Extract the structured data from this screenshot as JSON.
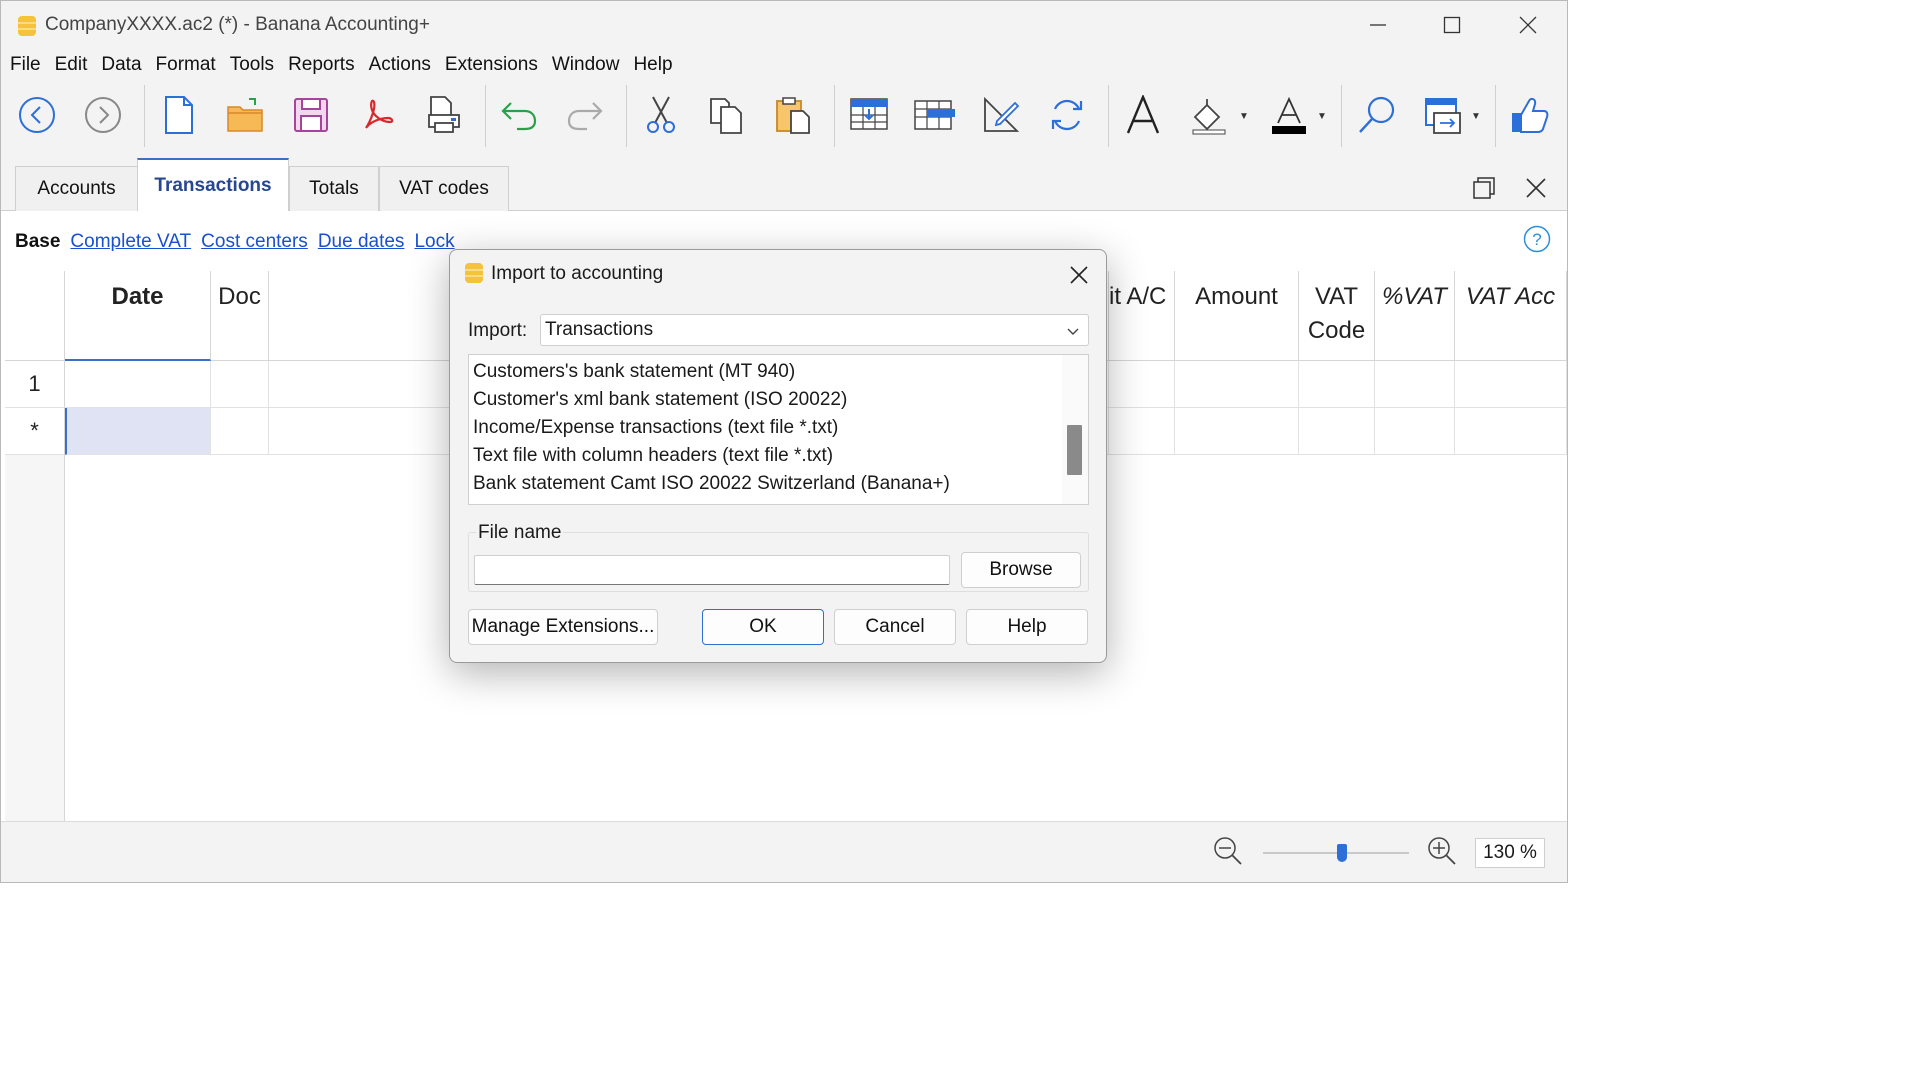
{
  "window": {
    "title": "CompanyXXXX.ac2 (*) - Banana Accounting+",
    "logo_icon": "banana-logo-icon",
    "controls": [
      "minimize-icon",
      "maximize-icon",
      "close-icon"
    ]
  },
  "menu": [
    "File",
    "Edit",
    "Data",
    "Format",
    "Tools",
    "Reports",
    "Actions",
    "Extensions",
    "Window",
    "Help"
  ],
  "toolbar": {
    "icons": [
      "back-icon",
      "forward-icon",
      "new-file-icon",
      "open-folder-icon",
      "save-icon",
      "pdf-icon",
      "print-preview-icon",
      "undo-icon",
      "redo-icon",
      "cut-icon",
      "copy-icon",
      "paste-icon",
      "insert-rows-icon",
      "add-rows-icon",
      "edit-icon",
      "recalculate-icon",
      "font-icon",
      "fill-color-icon",
      "text-color-icon",
      "find-icon",
      "window-switch-icon",
      "feedback-icon"
    ]
  },
  "tabs": {
    "items": [
      "Accounts",
      "Transactions",
      "Totals",
      "VAT codes"
    ],
    "active": "Transactions"
  },
  "views": {
    "base": "Base",
    "links": [
      "Complete VAT",
      "Cost centers",
      "Due dates",
      "Lock"
    ]
  },
  "grid": {
    "headers": {
      "date": "Date",
      "doc": "Doc",
      "credit": "it A/C",
      "amount": "Amount",
      "vat_code_1": "VAT",
      "vat_code_2": "Code",
      "pct_vat": "%VAT",
      "vat_acc": "VAT Acc"
    },
    "rows": [
      "1",
      "*"
    ]
  },
  "dialog": {
    "title": "Import to accounting",
    "import_label": "Import:",
    "import_value": "Transactions",
    "list_items": [
      "Customers's bank statement (MT 940)",
      "Customer's xml bank statement (ISO 20022)",
      "Income/Expense transactions (text file *.txt)",
      "Text file with column headers (text file *.txt)",
      "Bank statement Camt ISO 20022 Switzerland (Banana+)"
    ],
    "file_name_label": "File name",
    "file_name_value": "",
    "browse": "Browse",
    "manage": "Manage Extensions...",
    "ok": "OK",
    "cancel": "Cancel",
    "help": "Help"
  },
  "status": {
    "zoom": "130 %",
    "zoom_level_percent": 130
  },
  "colors": {
    "accent": "#2f6fd0",
    "active_tab_text": "#27488f",
    "link": "#1a4fd0",
    "selected_cell": "#dfe3f3"
  }
}
